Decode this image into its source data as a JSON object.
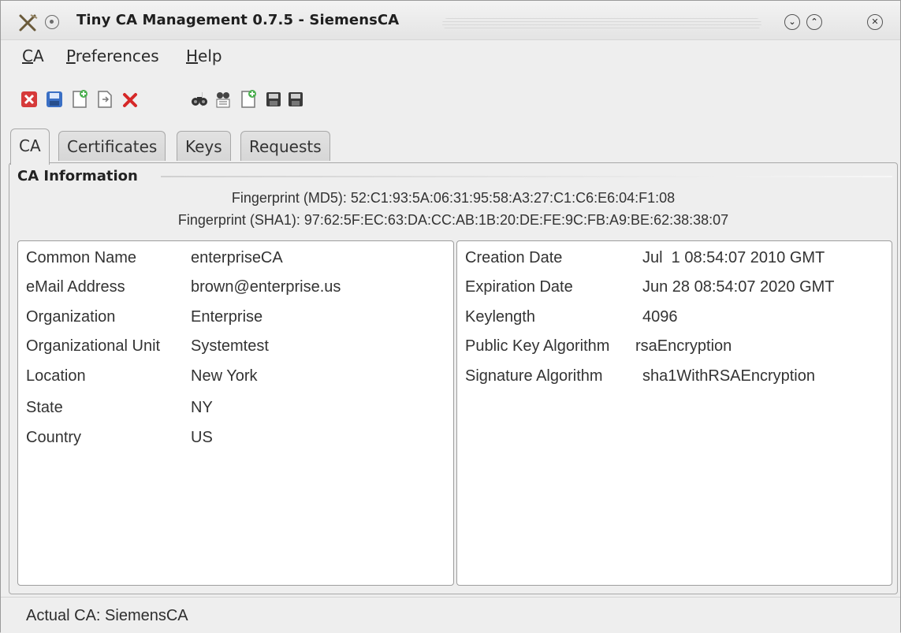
{
  "window": {
    "title": "Tiny CA Management 0.7.5 - SiemensCA",
    "buttons": [
      "minimize",
      "maximize",
      "close"
    ]
  },
  "menu": [
    {
      "label": "CA",
      "mnemonic": "C",
      "rest": "A"
    },
    {
      "label": "Preferences",
      "mnemonic": "P",
      "rest": "references"
    },
    {
      "label": "Help",
      "mnemonic": "H",
      "rest": "elp"
    }
  ],
  "toolbar": [
    {
      "name": "exit-icon",
      "color": "#d63a3a"
    },
    {
      "name": "save-icon",
      "color": "#3a6fc4"
    },
    {
      "name": "new-document-icon",
      "color": "#4caf50"
    },
    {
      "name": "import-document-icon",
      "color": "#777777"
    },
    {
      "name": "delete-icon",
      "color": "#d62828"
    },
    {
      "name": "binoculars-icon",
      "color": "#333333"
    },
    {
      "name": "view-details-icon",
      "color": "#555555"
    },
    {
      "name": "new-request-icon",
      "color": "#4caf50"
    },
    {
      "name": "export-disk-icon",
      "color": "#3a3a3a"
    },
    {
      "name": "export-disk-alt-icon",
      "color": "#3a3a3a"
    }
  ],
  "tabs": [
    {
      "label": "CA",
      "active": true
    },
    {
      "label": "Certificates",
      "active": false
    },
    {
      "label": "Keys",
      "active": false
    },
    {
      "label": "Requests",
      "active": false
    }
  ],
  "ca_info": {
    "heading": "CA Information",
    "fingerprint_md5": "Fingerprint (MD5): 52:C1:93:5A:06:31:95:58:A3:27:C1:C6:E6:04:F1:08",
    "fingerprint_sha1": "Fingerprint (SHA1): 97:62:5F:EC:63:DA:CC:AB:1B:20:DE:FE:9C:FB:A9:BE:62:38:38:07"
  },
  "subject": [
    {
      "label": "Common Name",
      "value": "enterpriseCA"
    },
    {
      "label": "eMail Address",
      "value": "brown@enterprise.us"
    },
    {
      "label": "Organization",
      "value": "Enterprise"
    },
    {
      "label": "Organizational Unit",
      "value": "Systemtest"
    },
    {
      "label": "Location",
      "value": "New York"
    },
    {
      "label": "State",
      "value": "NY"
    },
    {
      "label": "Country",
      "value": "US"
    }
  ],
  "details": [
    {
      "label": "Creation Date",
      "value": "Jul  1 08:54:07 2010 GMT"
    },
    {
      "label": "Expiration Date",
      "value": "Jun 28 08:54:07 2020 GMT"
    },
    {
      "label": "Keylength",
      "value": "4096"
    },
    {
      "label": "Public Key Algorithm",
      "value": "rsaEncryption"
    },
    {
      "label": "Signature Algorithm",
      "value": "sha1WithRSAEncryption"
    }
  ],
  "status": "Actual CA: SiemensCA"
}
